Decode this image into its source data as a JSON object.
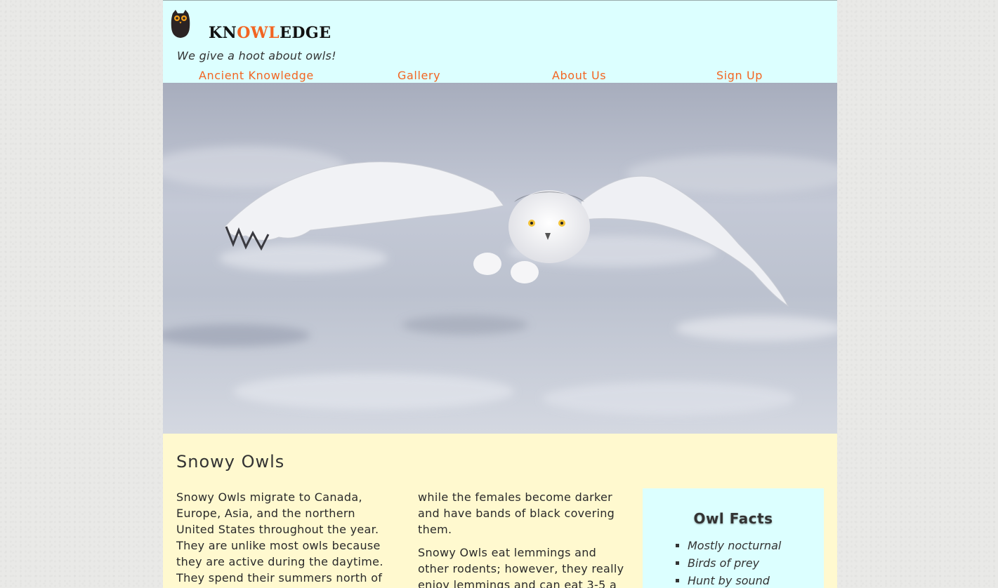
{
  "header": {
    "brand_prefix": "KN",
    "brand_highlight": "OWL",
    "brand_suffix": "EDGE",
    "tagline": "We give a hoot about owls!",
    "accent_color": "#f26522",
    "background_color": "#dcffff"
  },
  "nav": {
    "items": [
      {
        "label": "Ancient Knowledge"
      },
      {
        "label": "Gallery"
      },
      {
        "label": "About Us"
      },
      {
        "label": "Sign Up"
      }
    ]
  },
  "hero": {
    "icon": "snowy-owl-in-flight-photo"
  },
  "main": {
    "title": "Snowy Owls",
    "column1": {
      "paragraph1": "Snowy Owls migrate to Canada, Europe, Asia, and the northern United States throughout the year. They are unlike most owls because they are active during the daytime. They spend their summers north of"
    },
    "column2": {
      "paragraph1": "while the females become darker and have bands of black covering them.",
      "paragraph2": "Snowy Owls eat lemmings and other rodents; however, they really enjoy lemmings and can eat 3-5 a"
    },
    "background_color": "#fff9cf"
  },
  "facts": {
    "title": "Owl Facts",
    "items": [
      "Mostly nocturnal",
      "Birds of prey",
      "Hunt by sound"
    ]
  }
}
